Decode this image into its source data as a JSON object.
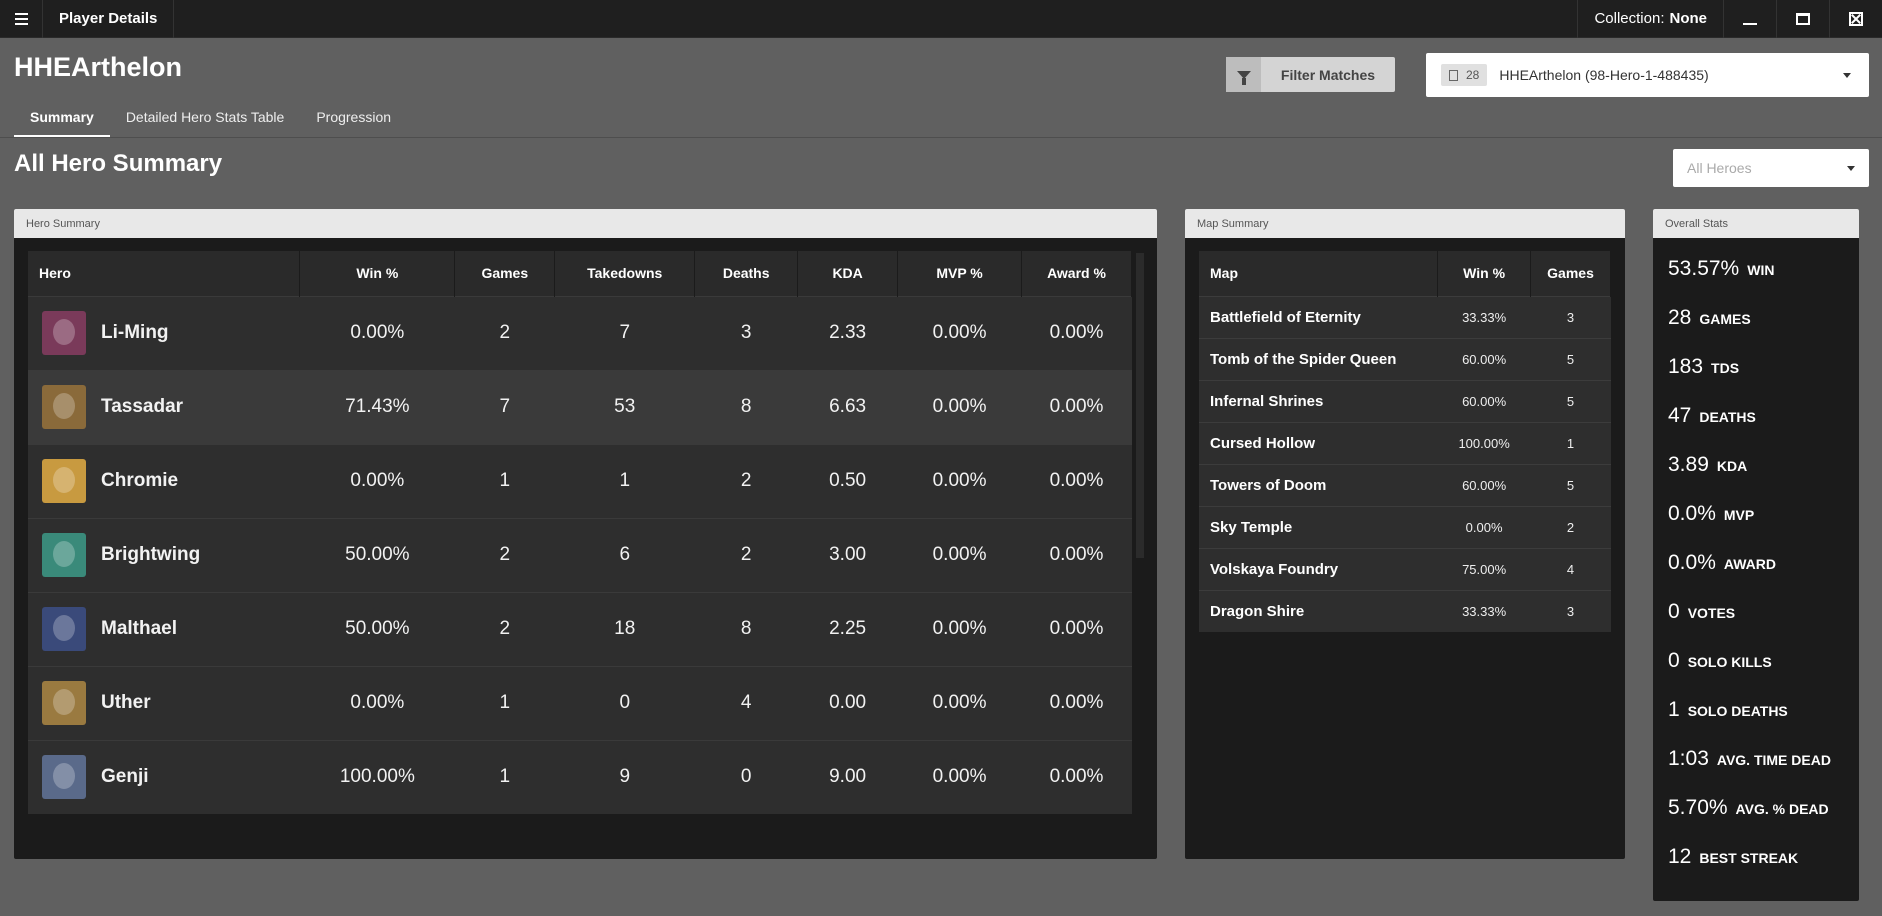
{
  "window": {
    "title": "Player Details",
    "collection_label": "Collection:",
    "collection_value": "None"
  },
  "player": {
    "name": "HHEArthelon",
    "badge_count": "28",
    "select_value": "HHEArthelon (98-Hero-1-488435)"
  },
  "toolbar": {
    "filter_label": "Filter Matches"
  },
  "tabs": [
    {
      "label": "Summary",
      "active": true
    },
    {
      "label": "Detailed Hero Stats Table",
      "active": false
    },
    {
      "label": "Progression",
      "active": false
    }
  ],
  "section": {
    "title": "All Hero Summary",
    "hero_filter_placeholder": "All Heroes"
  },
  "hero_summary": {
    "panel_title": "Hero Summary",
    "columns": [
      "Hero",
      "Win %",
      "Games",
      "Takedowns",
      "Deaths",
      "KDA",
      "MVP %",
      "Award %"
    ],
    "rows": [
      {
        "hero": "Li-Ming",
        "color": "#7a3a5a",
        "win": "0.00%",
        "games": "2",
        "takedowns": "7",
        "deaths": "3",
        "kda": "2.33",
        "mvp": "0.00%",
        "award": "0.00%"
      },
      {
        "hero": "Tassadar",
        "color": "#8a6a3a",
        "win": "71.43%",
        "games": "7",
        "takedowns": "53",
        "deaths": "8",
        "kda": "6.63",
        "mvp": "0.00%",
        "award": "0.00%"
      },
      {
        "hero": "Chromie",
        "color": "#c89a40",
        "win": "0.00%",
        "games": "1",
        "takedowns": "1",
        "deaths": "2",
        "kda": "0.50",
        "mvp": "0.00%",
        "award": "0.00%"
      },
      {
        "hero": "Brightwing",
        "color": "#3a8a7a",
        "win": "50.00%",
        "games": "2",
        "takedowns": "6",
        "deaths": "2",
        "kda": "3.00",
        "mvp": "0.00%",
        "award": "0.00%"
      },
      {
        "hero": "Malthael",
        "color": "#3a4a7a",
        "win": "50.00%",
        "games": "2",
        "takedowns": "18",
        "deaths": "8",
        "kda": "2.25",
        "mvp": "0.00%",
        "award": "0.00%"
      },
      {
        "hero": "Uther",
        "color": "#9a7a40",
        "win": "0.00%",
        "games": "1",
        "takedowns": "0",
        "deaths": "4",
        "kda": "0.00",
        "mvp": "0.00%",
        "award": "0.00%"
      },
      {
        "hero": "Genji",
        "color": "#5a6a8a",
        "win": "100.00%",
        "games": "1",
        "takedowns": "9",
        "deaths": "0",
        "kda": "9.00",
        "mvp": "0.00%",
        "award": "0.00%"
      }
    ]
  },
  "map_summary": {
    "panel_title": "Map Summary",
    "columns": [
      "Map",
      "Win %",
      "Games"
    ],
    "rows": [
      {
        "map": "Battlefield of Eternity",
        "win": "33.33%",
        "games": "3"
      },
      {
        "map": "Tomb of the Spider Queen",
        "win": "60.00%",
        "games": "5"
      },
      {
        "map": "Infernal Shrines",
        "win": "60.00%",
        "games": "5"
      },
      {
        "map": "Cursed Hollow",
        "win": "100.00%",
        "games": "1"
      },
      {
        "map": "Towers of Doom",
        "win": "60.00%",
        "games": "5"
      },
      {
        "map": "Sky Temple",
        "win": "0.00%",
        "games": "2"
      },
      {
        "map": "Volskaya Foundry",
        "win": "75.00%",
        "games": "4"
      },
      {
        "map": "Dragon Shire",
        "win": "33.33%",
        "games": "3"
      }
    ]
  },
  "overall_stats": {
    "panel_title": "Overall Stats",
    "items": [
      {
        "value": "53.57%",
        "label": "WIN"
      },
      {
        "value": "28",
        "label": "GAMES"
      },
      {
        "value": "183",
        "label": "TDS"
      },
      {
        "value": "47",
        "label": "DEATHS"
      },
      {
        "value": "3.89",
        "label": "KDA"
      },
      {
        "value": "0.0%",
        "label": "MVP"
      },
      {
        "value": "0.0%",
        "label": "AWARD"
      },
      {
        "value": "0",
        "label": "VOTES"
      },
      {
        "value": "0",
        "label": "SOLO KILLS"
      },
      {
        "value": "1",
        "label": "SOLO DEATHS"
      },
      {
        "value": "1:03",
        "label": "AVG. TIME DEAD"
      },
      {
        "value": "5.70%",
        "label": "AVG. % DEAD"
      },
      {
        "value": "12",
        "label": "BEST STREAK"
      }
    ]
  }
}
